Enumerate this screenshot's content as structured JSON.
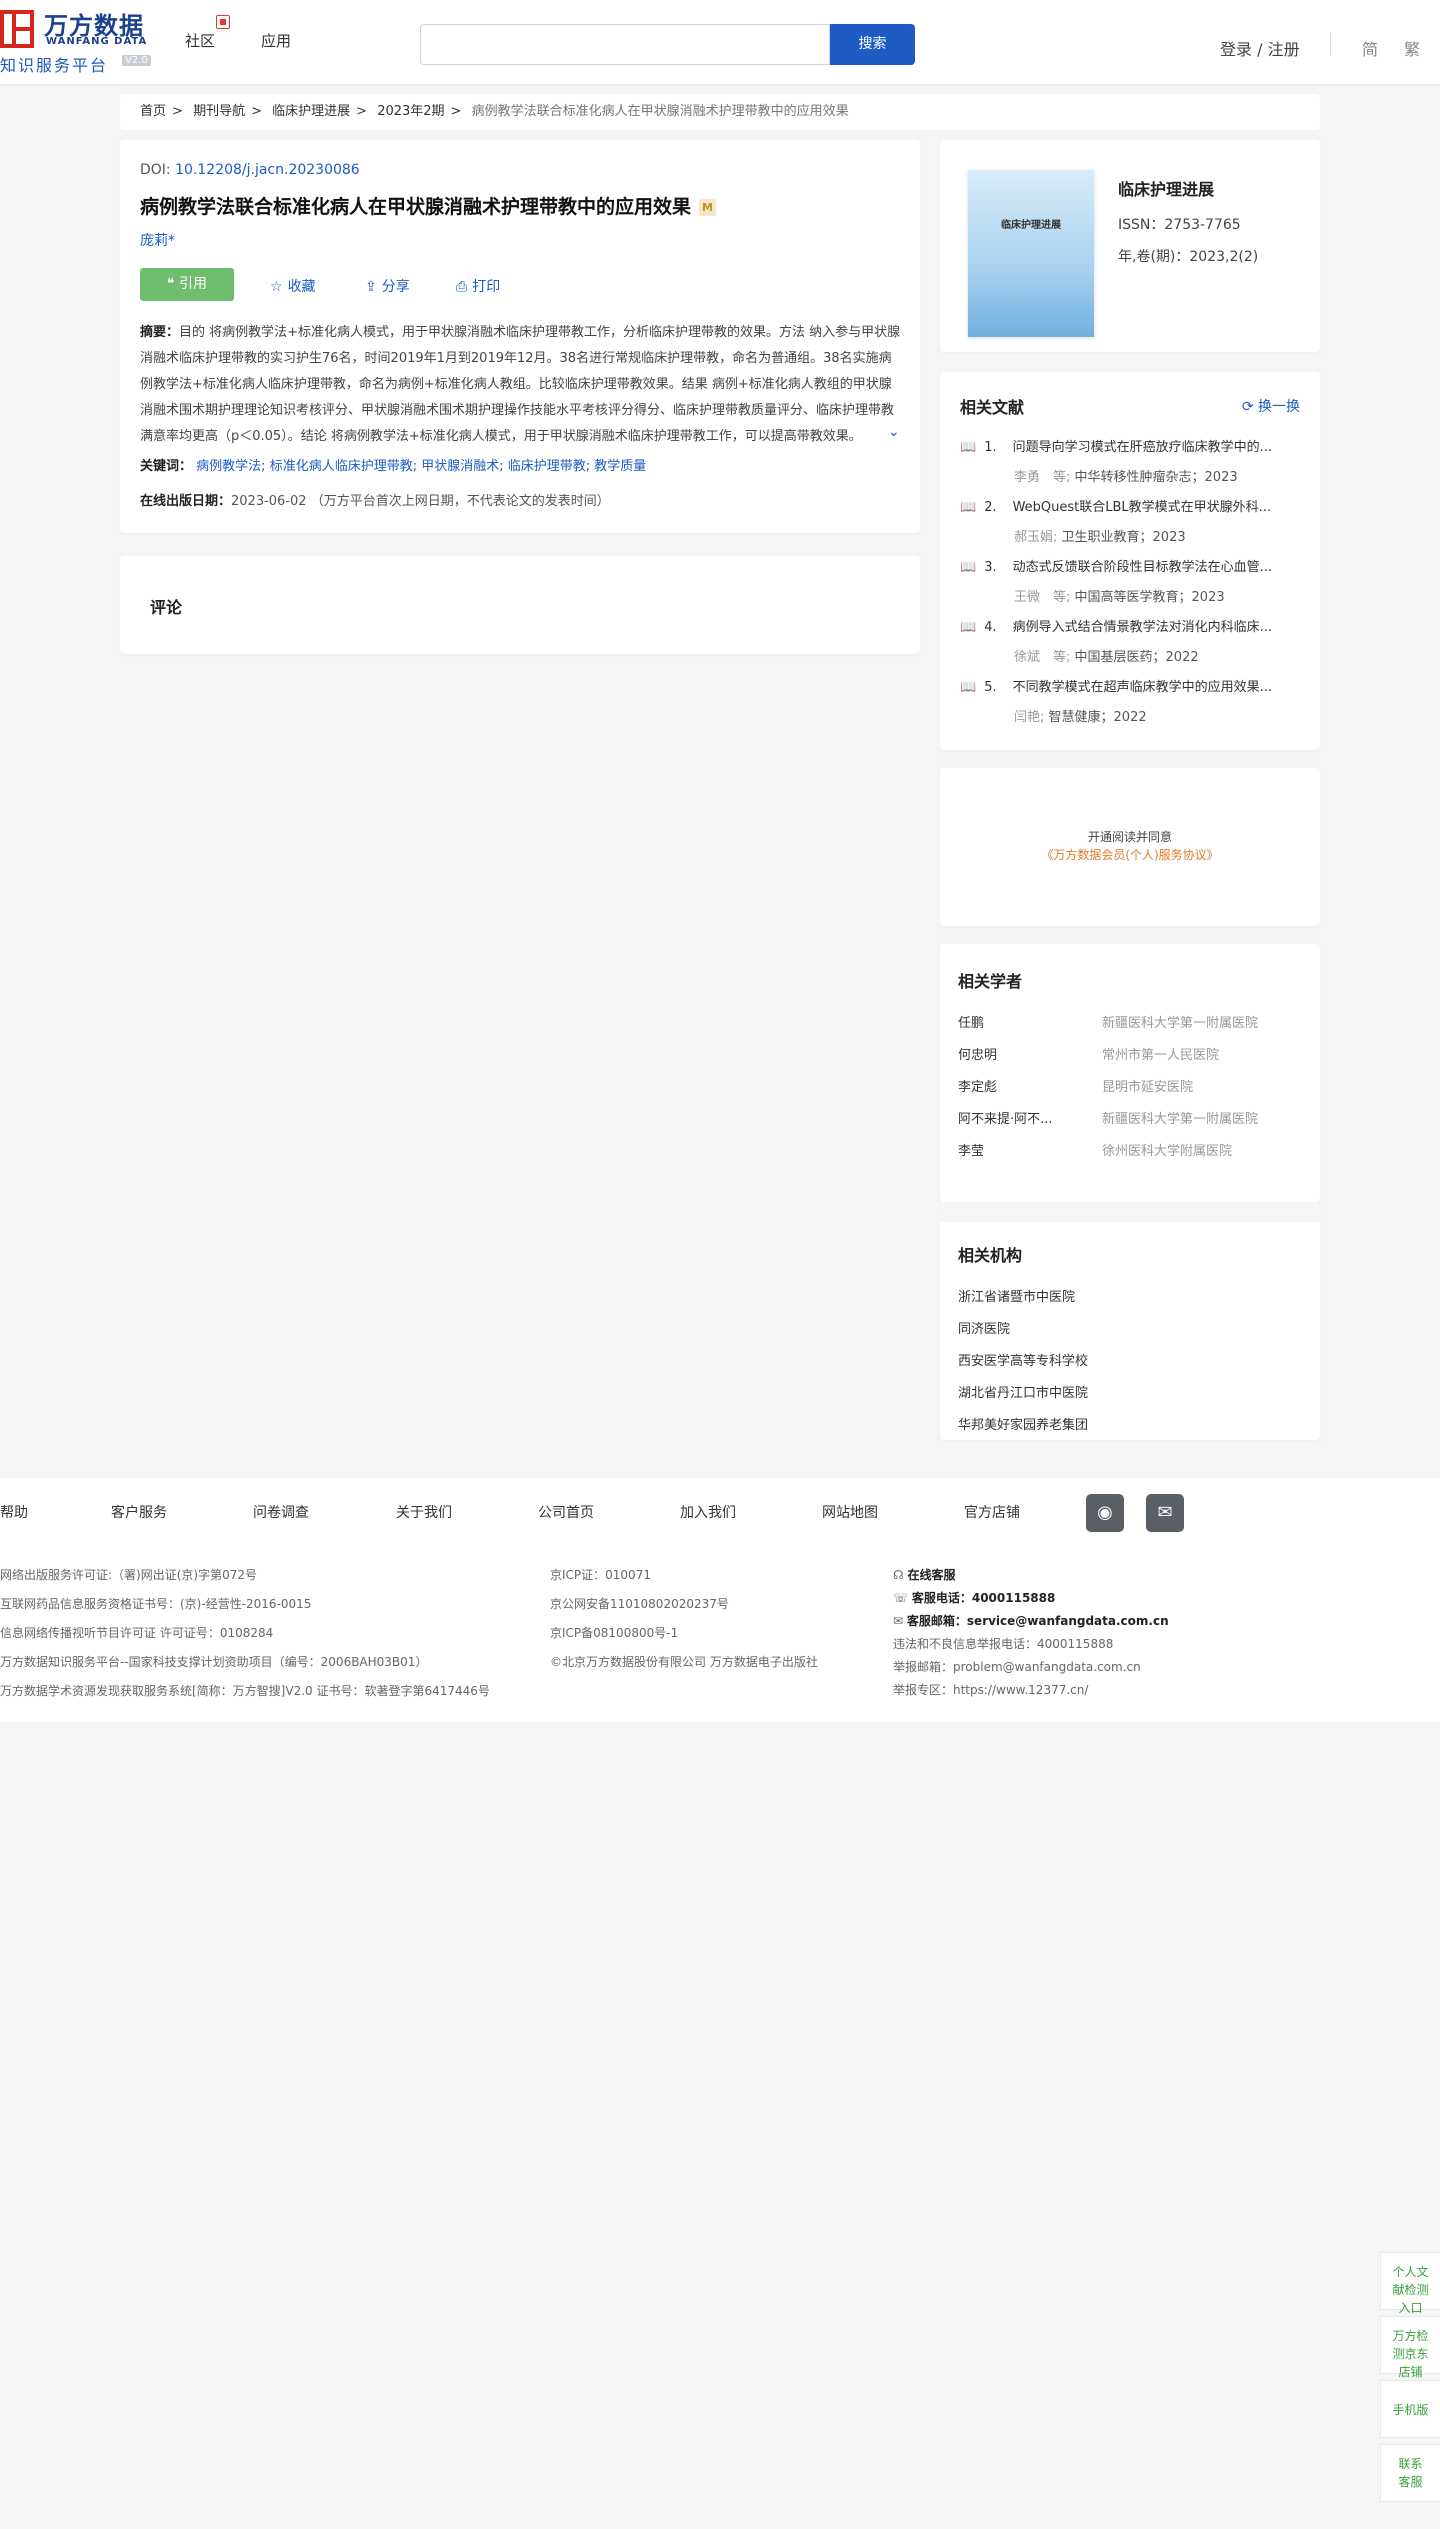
{
  "header": {
    "logo_cn": "万方数据",
    "logo_en": "WANFANG DATA",
    "logo_sub": "知识服务平台",
    "logo_ver": "V2.0",
    "nav": [
      "社区",
      "应用"
    ],
    "search_placeholder": "",
    "search_button": "搜索",
    "login": "登录 / 注册",
    "lang_simple": "简",
    "lang_trad": "繁"
  },
  "breadcrumb": [
    "首页",
    "期刊导航",
    "临床护理进展",
    "2023年2期",
    "病例教学法联合标准化病人在甲状腺消融术护理带教中的应用效果"
  ],
  "article": {
    "doi_label": "DOI:",
    "doi": "10.12208/j.jacn.20230086",
    "title": "病例教学法联合标准化病人在甲状腺消融术护理带教中的应用效果",
    "badge": "M",
    "author": "庞莉*",
    "actions": {
      "cite": "引用",
      "collect": "收藏",
      "share": "分享",
      "print": "打印"
    },
    "abstract_label": "摘要：",
    "abstract": "目的 将病例教学法+标准化病人模式，用于甲状腺消融术临床护理带教工作，分析临床护理带教的效果。方法 纳入参与甲状腺消融术临床护理带教的实习护生76名，时间2019年1月到2019年12月。38名进行常规临床护理带教，命名为普通组。38名实施病例教学法+标准化病人临床护理带教，命名为病例+标准化病人教组。比较临床护理带教效果。结果 病例+标准化病人教组的甲状腺消融术围术期护理理论知识考核评分、甲状腺消融术围术期护理操作技能水平考核评分得分、临床护理带教质量评分、临床护理带教满意率均更高（p＜0.05）。结论 将病例教学法+标准化病人模式，用于甲状腺消融术临床护理带教工作，可以提高带教效果。",
    "keywords_label": "关键词：",
    "keywords": [
      "病例教学法;",
      "标准化病人临床护理带教;",
      "甲状腺消融术;",
      "临床护理带教;",
      "教学质量"
    ],
    "pubdate_label": "在线出版日期：",
    "pubdate": "2023-06-02",
    "pubdate_note": "（万方平台首次上网日期，不代表论文的发表时间）"
  },
  "comment": {
    "title": "评论"
  },
  "journal": {
    "cover_title": "临床护理进展",
    "name": "临床护理进展",
    "issn": "ISSN：2753-7765",
    "vol": "年,卷(期)：2023,2(2)"
  },
  "related_docs": {
    "title": "相关文献",
    "swap": "换一换",
    "items": [
      {
        "num": "1.",
        "title": "问题导向学习模式在肝癌放疗临床教学中的...",
        "authors": "李勇　等;",
        "source": "中华转移性肿瘤杂志；2023"
      },
      {
        "num": "2.",
        "title": "WebQuest联合LBL教学模式在甲状腺外科...",
        "authors": "郝玉娟;",
        "source": "卫生职业教育；2023"
      },
      {
        "num": "3.",
        "title": "动态式反馈联合阶段性目标教学法在心血管...",
        "authors": "王微　等;",
        "source": "中国高等医学教育；2023"
      },
      {
        "num": "4.",
        "title": "病例导入式结合情景教学法对消化内科临床...",
        "authors": "徐斌　等;",
        "source": "中国基层医药；2022"
      },
      {
        "num": "5.",
        "title": "不同教学模式在超声临床教学中的应用效果...",
        "authors": "闫艳;",
        "source": "智慧健康；2022"
      }
    ]
  },
  "open_read": {
    "line1": "开通阅读并同意",
    "line2": "《万方数据会员(个人)服务协议》"
  },
  "scholars": {
    "title": "相关学者",
    "items": [
      {
        "name": "任鹏",
        "org": "新疆医科大学第一附属医院"
      },
      {
        "name": "何忠明",
        "org": "常州市第一人民医院"
      },
      {
        "name": "李定彪",
        "org": "昆明市延安医院"
      },
      {
        "name": "阿不来提·阿不...",
        "org": "新疆医科大学第一附属医院"
      },
      {
        "name": "李莹",
        "org": "徐州医科大学附属医院"
      }
    ]
  },
  "orgs": {
    "title": "相关机构",
    "items": [
      "浙江省诸暨市中医院",
      "同济医院",
      "西安医学高等专科学校",
      "湖北省丹江口市中医院",
      "华邦美好家园养老集团"
    ]
  },
  "footer": {
    "links": [
      "帮助",
      "客户服务",
      "问卷调查",
      "关于我们",
      "公司首页",
      "加入我们",
      "网站地图",
      "官方店铺"
    ],
    "social": [
      "weibo-icon",
      "wechat-icon"
    ],
    "col1": [
      "网络出版服务许可证:（署)网出证(京)字第072号",
      "互联网药品信息服务资格证书号：(京)-经营性-2016-0015",
      "信息网络传播视听节目许可证 许可证号：0108284",
      "万方数据知识服务平台--国家科技支撑计划资助项目（编号：2006BAH03B01）",
      "万方数据学术资源发现获取服务系统[简称：万方智搜]V2.0 证书号：软著登字第6417446号"
    ],
    "col2": [
      "京ICP证：010071",
      "京公网安备11010802020237号",
      "京ICP备08100800号-1",
      "©北京万方数据股份有限公司 万方数据电子出版社"
    ],
    "service_label": "在线客服",
    "phone_label": "客服电话：",
    "phone": "4000115888",
    "mail_label": "客服邮箱：",
    "mail": "service@wanfangdata.com.cn",
    "report_phone": "违法和不良信息举报电话：4000115888",
    "report_mail": "举报邮箱：problem@wanfangdata.com.cn",
    "report_area": "举报专区：https://www.12377.cn/"
  },
  "side_float": [
    "个人文献检测入口",
    "万方检测京东店铺",
    "手机版",
    "联系客服"
  ]
}
